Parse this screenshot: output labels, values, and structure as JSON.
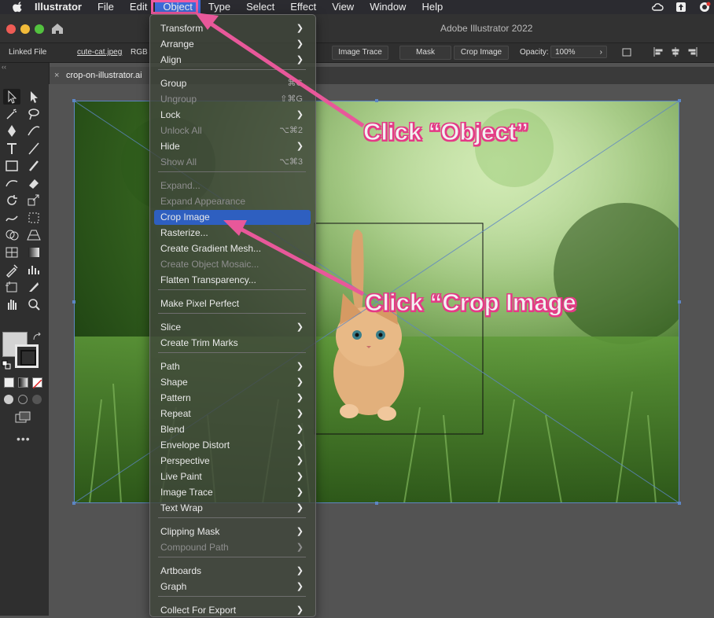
{
  "menubar": {
    "app": "Illustrator",
    "items": [
      "File",
      "Edit",
      "Object",
      "Type",
      "Select",
      "Effect",
      "View",
      "Window",
      "Help"
    ],
    "active": "Object"
  },
  "window": {
    "title": "Adobe Illustrator 2022"
  },
  "control_bar": {
    "linked_file": "Linked File",
    "filename": "cute-cat.jpeg",
    "color_mode": "RGB",
    "image_trace": "Image Trace",
    "mask": "Mask",
    "crop_image": "Crop Image",
    "opacity_label": "Opacity:",
    "opacity_value": "100%"
  },
  "document_tab": {
    "name": "crop-on-illustrator.ai",
    "close": "×"
  },
  "object_menu": {
    "items": [
      {
        "label": "Transform",
        "submenu": true
      },
      {
        "label": "Arrange",
        "submenu": true
      },
      {
        "label": "Align",
        "submenu": true
      },
      {
        "label": "Group",
        "shortcut": "⌘G"
      },
      {
        "label": "Ungroup",
        "shortcut": "⇧⌘G",
        "disabled": true
      },
      {
        "label": "Lock",
        "submenu": true
      },
      {
        "label": "Unlock All",
        "shortcut": "⌥⌘2",
        "disabled": true
      },
      {
        "label": "Hide",
        "submenu": true
      },
      {
        "label": "Show All",
        "shortcut": "⌥⌘3",
        "disabled": true
      },
      {
        "label": "Expand...",
        "disabled": true
      },
      {
        "label": "Expand Appearance",
        "disabled": true
      },
      {
        "label": "Crop Image",
        "highlighted": true
      },
      {
        "label": "Rasterize..."
      },
      {
        "label": "Create Gradient Mesh..."
      },
      {
        "label": "Create Object Mosaic...",
        "disabled": true
      },
      {
        "label": "Flatten Transparency..."
      },
      {
        "label": "Make Pixel Perfect"
      },
      {
        "label": "Slice",
        "submenu": true
      },
      {
        "label": "Create Trim Marks"
      },
      {
        "label": "Path",
        "submenu": true
      },
      {
        "label": "Shape",
        "submenu": true
      },
      {
        "label": "Pattern",
        "submenu": true
      },
      {
        "label": "Repeat",
        "submenu": true
      },
      {
        "label": "Blend",
        "submenu": true
      },
      {
        "label": "Envelope Distort",
        "submenu": true
      },
      {
        "label": "Perspective",
        "submenu": true
      },
      {
        "label": "Live Paint",
        "submenu": true
      },
      {
        "label": "Image Trace",
        "submenu": true
      },
      {
        "label": "Text Wrap",
        "submenu": true
      },
      {
        "label": "Clipping Mask",
        "submenu": true
      },
      {
        "label": "Compound Path",
        "submenu": true,
        "disabled": true
      },
      {
        "label": "Artboards",
        "submenu": true
      },
      {
        "label": "Graph",
        "submenu": true
      },
      {
        "label": "Collect For Export",
        "submenu": true
      }
    ]
  },
  "annotations": {
    "object": "Click “Object”",
    "crop": "Click “Crop Image"
  },
  "colors": {
    "accent": "#2e5fc0",
    "callout": "#e43a86"
  }
}
